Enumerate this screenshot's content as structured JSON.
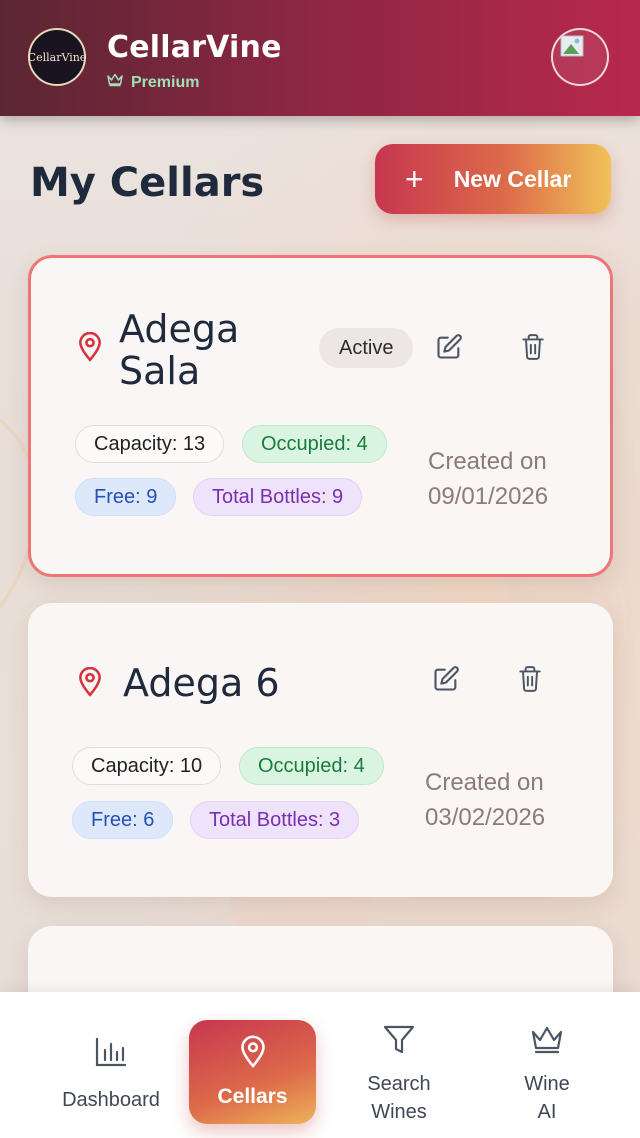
{
  "header": {
    "logo_text": "CellarVine",
    "app_title": "CellarVine",
    "plan_label": "Premium"
  },
  "page": {
    "title": "My Cellars",
    "new_button_label": "New Cellar"
  },
  "cellars": [
    {
      "name_line1": "Adega",
      "name_line2": "Sala",
      "status": "Active",
      "capacity": "Capacity: 13",
      "occupied": "Occupied: 4",
      "free": "Free: 9",
      "total": "Total Bottles: 9",
      "created_label": "Created on",
      "created_date": "09/01/2026"
    },
    {
      "name": "Adega 6",
      "capacity": "Capacity: 10",
      "occupied": "Occupied: 4",
      "free": "Free: 6",
      "total": "Total Bottles: 3",
      "created_label": "Created on",
      "created_date": "03/02/2026"
    }
  ],
  "nav": {
    "dashboard": "Dashboard",
    "cellars": "Cellars",
    "search_line1": "Search",
    "search_line2": "Wines",
    "ai_line1": "Wine",
    "ai_line2": "AI"
  },
  "icons": {
    "location": "map-pin-icon",
    "edit": "edit-icon",
    "delete": "trash-icon",
    "crown": "crown-icon",
    "plus": "plus-icon",
    "chart": "bar-chart-icon",
    "filter": "filter-icon"
  },
  "colors": {
    "header_start": "#5b2633",
    "header_end": "#b8284c",
    "accent_start": "#c7364f",
    "accent_end": "#f0c259",
    "active_border": "#ee7676",
    "pin_red": "#d6333d"
  }
}
